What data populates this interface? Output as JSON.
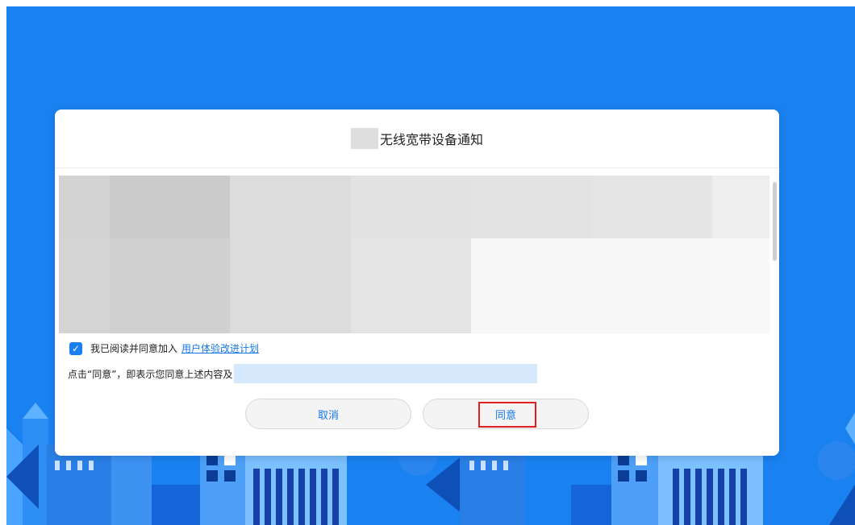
{
  "dialog": {
    "title": "无线宽带设备通知",
    "agree_checkbox_checked": true,
    "agree_text": "我已阅读并同意加入",
    "agree_link": "用户体验改进计划",
    "notice_text": "点击“同意”，即表示您同意上述内容及",
    "cancel_label": "取消",
    "agree_label": "同意"
  },
  "colors": {
    "background_blue": "#1a82f0",
    "accent_blue": "#1677e8",
    "highlight_red": "#e02020"
  },
  "icons": {
    "checkbox": "checkmark-icon"
  }
}
